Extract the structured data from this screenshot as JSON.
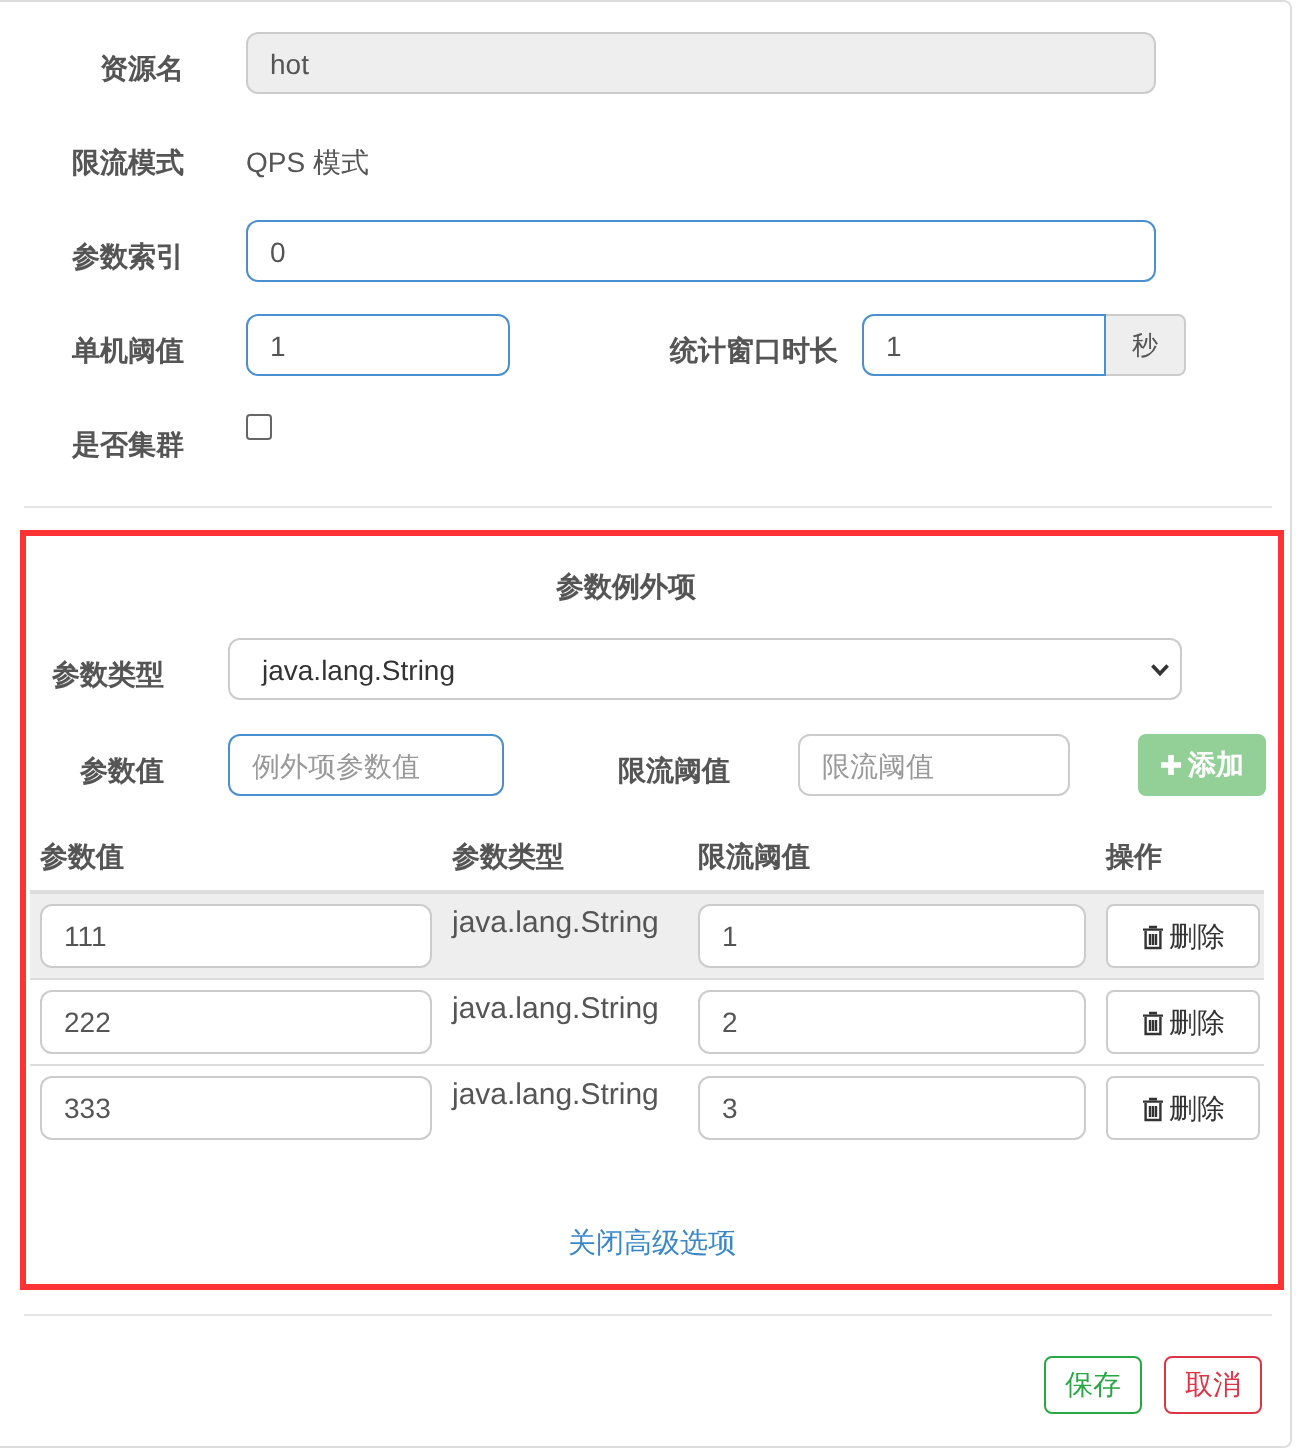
{
  "resource": {
    "label": "资源名",
    "value": "hot",
    "disabled": true,
    "highlighted": false
  },
  "mode": {
    "label": "限流模式",
    "value": "QPS 模式"
  },
  "param_index": {
    "label": "参数索引",
    "value": "0",
    "disabled": false,
    "highlighted": true
  },
  "threshold": {
    "label": "单机阈值",
    "value": "1",
    "highlighted": true
  },
  "window": {
    "label": "统计窗口时长",
    "value": "1",
    "unit": "秒",
    "highlighted": true
  },
  "cluster": {
    "label": "是否集群",
    "checked": false
  },
  "exceptions": {
    "title": "参数例外项",
    "param_type": {
      "label": "参数类型",
      "value": "java.lang.String"
    },
    "param_value": {
      "label": "参数值",
      "placeholder": "例外项参数值",
      "highlighted": true
    },
    "limit": {
      "label": "限流阈值",
      "placeholder": "限流阈值",
      "highlighted": false
    },
    "add_button": {
      "label": "添加",
      "disabled": true
    },
    "table": {
      "columns": [
        "参数值",
        "参数类型",
        "限流阈值",
        "操作"
      ],
      "rows": [
        {
          "value": "111",
          "type": "java.lang.String",
          "limit": "1",
          "action": "删除",
          "hovered": true
        },
        {
          "value": "222",
          "type": "java.lang.String",
          "limit": "2",
          "action": "删除",
          "hovered": false
        },
        {
          "value": "333",
          "type": "java.lang.String",
          "limit": "3",
          "action": "删除",
          "hovered": false
        }
      ]
    },
    "toggle_link": "关闭高级选项"
  },
  "buttons": [
    {
      "label": "保存",
      "kind": "save"
    },
    {
      "label": "取消",
      "kind": "cancel"
    }
  ]
}
